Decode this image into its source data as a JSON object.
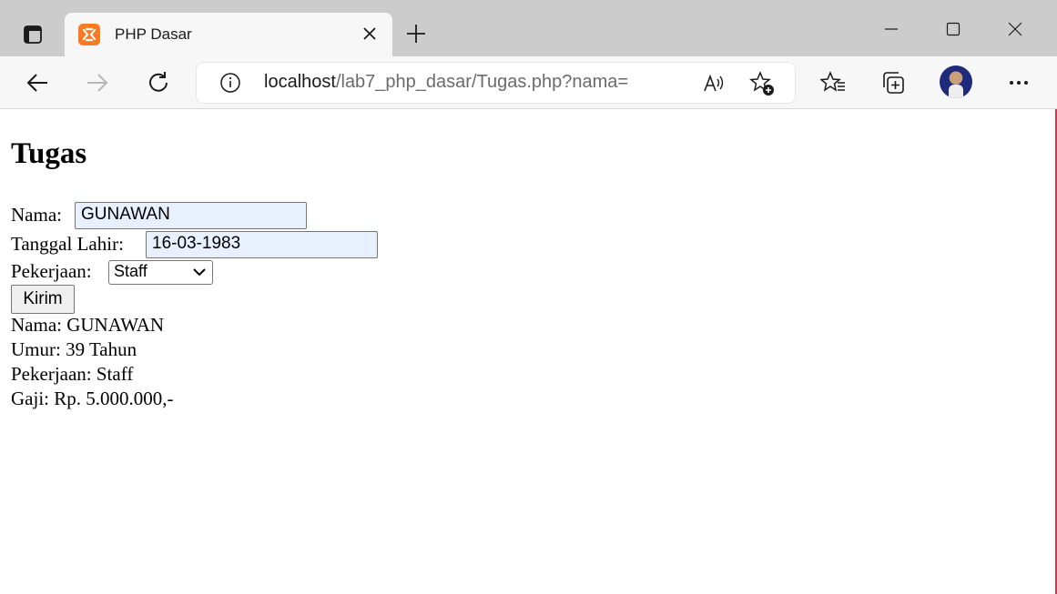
{
  "browser": {
    "tab": {
      "title": "PHP Dasar"
    },
    "address": {
      "host": "localhost",
      "path": "/lab7_php_dasar/Tugas.php?nama="
    }
  },
  "form": {
    "heading": "Tugas",
    "nama_label": "Nama:",
    "nama_value": "GUNAWAN",
    "tanggal_label": "Tanggal Lahir:",
    "tanggal_value": "16-03-1983",
    "pekerjaan_label": "Pekerjaan:",
    "pekerjaan_selected": "Staff",
    "submit_label": "Kirim"
  },
  "result": {
    "lines": [
      "Nama: GUNAWAN",
      "Umur: 39 Tahun",
      "Pekerjaan: Staff",
      "Gaji: Rp. 5.000.000,-"
    ]
  },
  "colors": {
    "favicon": "#fb7a24",
    "avatar": "#1f2b7a"
  },
  "icons": {
    "tab_actions": "tab-actions-icon",
    "close": "close-icon",
    "new_tab": "plus-icon",
    "back": "back-arrow-icon",
    "forward": "forward-arrow-icon",
    "refresh": "refresh-icon",
    "info": "info-icon",
    "read_aloud": "read-aloud-icon",
    "add_favorite": "star-add-icon",
    "favorites": "favorites-icon",
    "collections": "collections-icon",
    "more": "more-icon"
  }
}
